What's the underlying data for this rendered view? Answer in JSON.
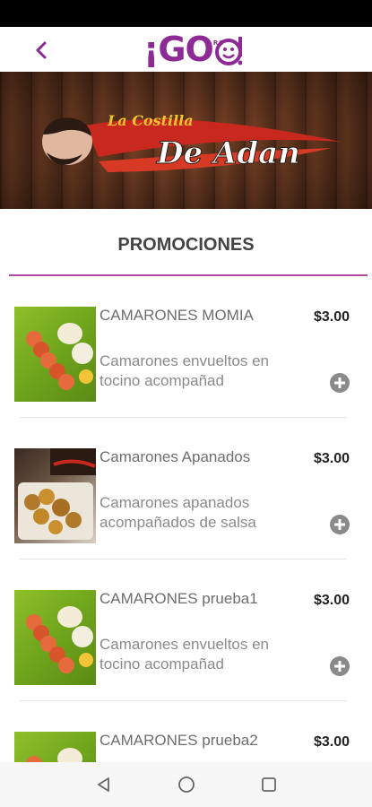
{
  "header": {
    "logo_text": "¡GO",
    "logo_badge_rc": "R.C",
    "brand_color": "#8e2a95"
  },
  "banner": {
    "logo_text_line1": "La Costilla",
    "logo_text_line2": "De Adan"
  },
  "section": {
    "title": "PROMOCIONES",
    "accent_color": "#b14aa3"
  },
  "items": [
    {
      "name": "CAMARONES MOMIA",
      "price": "$3.00",
      "description": "Camarones envueltos en tocino acompañad",
      "image": "shrimp-bacon-photo"
    },
    {
      "name": "Camarones Apanados",
      "price": "$3.00",
      "description": "Camarones apanados acompañados de salsa",
      "image": "breaded-shrimp-photo"
    },
    {
      "name": "CAMARONES prueba1",
      "price": "$3.00",
      "description": "Camarones envueltos en tocino acompañad",
      "image": "shrimp-bacon-photo"
    },
    {
      "name": "CAMARONES prueba2",
      "price": "$3.00",
      "description": "",
      "image": "shrimp-bacon-photo"
    }
  ],
  "icons": {
    "back": "chevron-left-icon",
    "add": "plus-circle-icon",
    "nav_back": "triangle-back-icon",
    "nav_home": "circle-home-icon",
    "nav_recents": "square-recents-icon"
  }
}
